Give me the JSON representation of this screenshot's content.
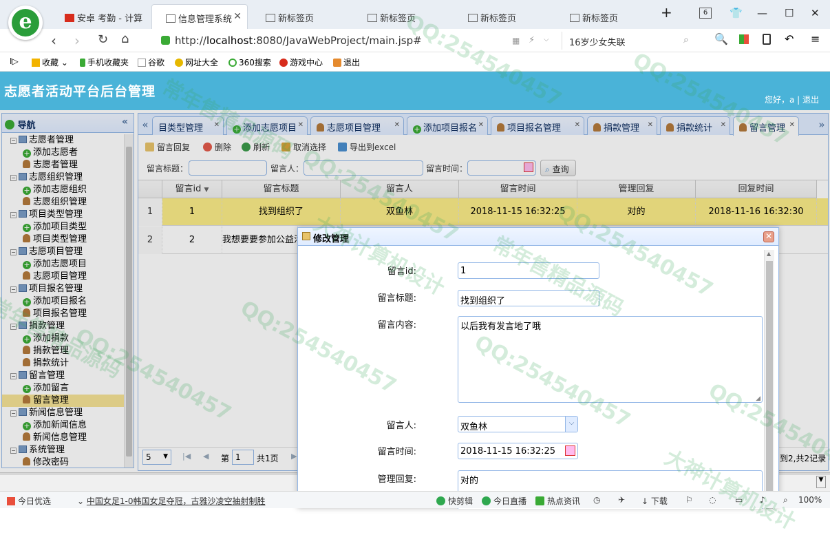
{
  "browser": {
    "tabs": [
      {
        "label": "安卓 考勤 - 计算",
        "active": false
      },
      {
        "label": "信息管理系统",
        "active": true
      },
      {
        "label": "新标签页",
        "active": false
      },
      {
        "label": "新标签页",
        "active": false
      },
      {
        "label": "新标签页",
        "active": false
      },
      {
        "label": "新标签页",
        "active": false
      }
    ],
    "tab_count": "6",
    "url_prefix": "http://",
    "url_host": "localhost",
    "url_rest": ":8080/JavaWebProject/main.jsp#",
    "search_text": "16岁少女失联",
    "bookmarks": [
      "收藏",
      "手机收藏夹",
      "谷歌",
      "网址大全",
      "360搜索",
      "游戏中心",
      "退出"
    ]
  },
  "app": {
    "title": "志愿者活动平台后台管理",
    "greeting": "您好，a | 退出"
  },
  "nav": {
    "title": "导航",
    "collapse": "«",
    "groups": [
      {
        "label": "志愿者管理",
        "children": [
          "添加志愿者",
          "志愿者管理"
        ]
      },
      {
        "label": "志愿组织管理",
        "children": [
          "添加志愿组织",
          "志愿组织管理"
        ]
      },
      {
        "label": "项目类型管理",
        "children": [
          "添加项目类型",
          "项目类型管理"
        ]
      },
      {
        "label": "志愿项目管理",
        "children": [
          "添加志愿项目",
          "志愿项目管理"
        ]
      },
      {
        "label": "项目报名管理",
        "children": [
          "添加项目报名",
          "项目报名管理"
        ]
      },
      {
        "label": "捐款管理",
        "children": [
          "添加捐款",
          "捐款管理",
          "捐款统计"
        ]
      },
      {
        "label": "留言管理",
        "children": [
          "添加留言",
          "留言管理"
        ]
      },
      {
        "label": "新闻信息管理",
        "children": [
          "添加新闻信息",
          "新闻信息管理"
        ]
      },
      {
        "label": "系统管理",
        "children": [
          "修改密码"
        ]
      }
    ],
    "selected": "留言管理"
  },
  "tabs": [
    {
      "label": "目类型管理",
      "icon": "user"
    },
    {
      "label": "添加志愿项目",
      "icon": "add"
    },
    {
      "label": "志愿项目管理",
      "icon": "user"
    },
    {
      "label": "添加项目报名",
      "icon": "add"
    },
    {
      "label": "项目报名管理",
      "icon": "user"
    },
    {
      "label": "捐款管理",
      "icon": "user"
    },
    {
      "label": "捐款统计",
      "icon": "user"
    },
    {
      "label": "留言管理",
      "icon": "user",
      "active": true
    }
  ],
  "toolbar": {
    "reply": "留言回复",
    "delete": "删除",
    "refresh": "刷新",
    "unselect": "取消选择",
    "export": "导出到excel"
  },
  "search": {
    "title_label": "留言标题：",
    "person_label": "留言人：",
    "time_label": "留言时间：",
    "query": "查询"
  },
  "grid": {
    "columns": [
      "留言id",
      "留言标题",
      "留言人",
      "留言时间",
      "管理回复",
      "回复时间"
    ],
    "rows": [
      {
        "num": "1",
        "id": "1",
        "title": "找到组织了",
        "person": "双鱼林",
        "time": "2018-11-15 16:32:25",
        "reply": "对的",
        "reply_time": "2018-11-16 16:32:30"
      },
      {
        "num": "2",
        "id": "2",
        "title": "我想要要参加公益活",
        "person": "",
        "time": "",
        "reply": "",
        "reply_time": ""
      }
    ]
  },
  "pager": {
    "page_size": "5",
    "page_prefix": "第",
    "page_value": "1",
    "page_total": "共1页",
    "summary": "到2,共2记录"
  },
  "modal": {
    "title": "修改管理",
    "fields": {
      "id_label": "留言id:",
      "id_value": "1",
      "title_label": "留言标题:",
      "title_value": "找到组织了",
      "content_label": "留言内容:",
      "content_value": "以后我有发言地了哦",
      "person_label": "留言人:",
      "person_value": "双鱼林",
      "time_label": "留言时间:",
      "time_value": "2018-11-15 16:32:25",
      "reply_label": "管理回复:",
      "reply_value": "对的"
    }
  },
  "statusbar": {
    "left": "今日优选",
    "news": "中国女足1-0韩国女足夺冠，古雅沙凌空抽射制胜",
    "items": [
      "快剪辑",
      "今日直播",
      "热点资讯"
    ],
    "download": "下载",
    "zoom": "100%"
  },
  "watermark": {
    "qq": "QQ:254540457",
    "slogan1": "常年售精品源码",
    "slogan2": "大神计算机设计"
  }
}
